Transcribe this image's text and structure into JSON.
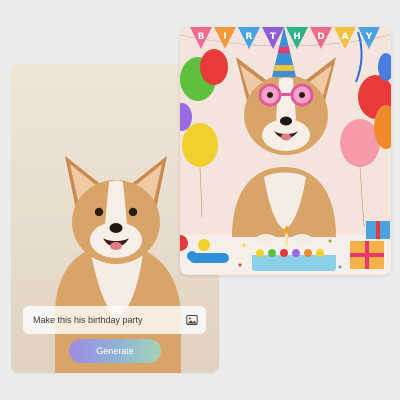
{
  "prompt": {
    "text": "Make this his birthday party",
    "icon": "image-icon"
  },
  "generate_button": {
    "label": "Generate"
  },
  "result": {
    "banner_text": "BIRTHDAY",
    "banner_letters": [
      "B",
      "I",
      "R",
      "T",
      "H",
      "D",
      "A",
      "Y"
    ]
  },
  "colors": {
    "background": "#ececec",
    "button_gradient_start": "#9c8ce6",
    "button_gradient_end": "#a6d3b6",
    "corgi_fur": "#d9a467"
  }
}
